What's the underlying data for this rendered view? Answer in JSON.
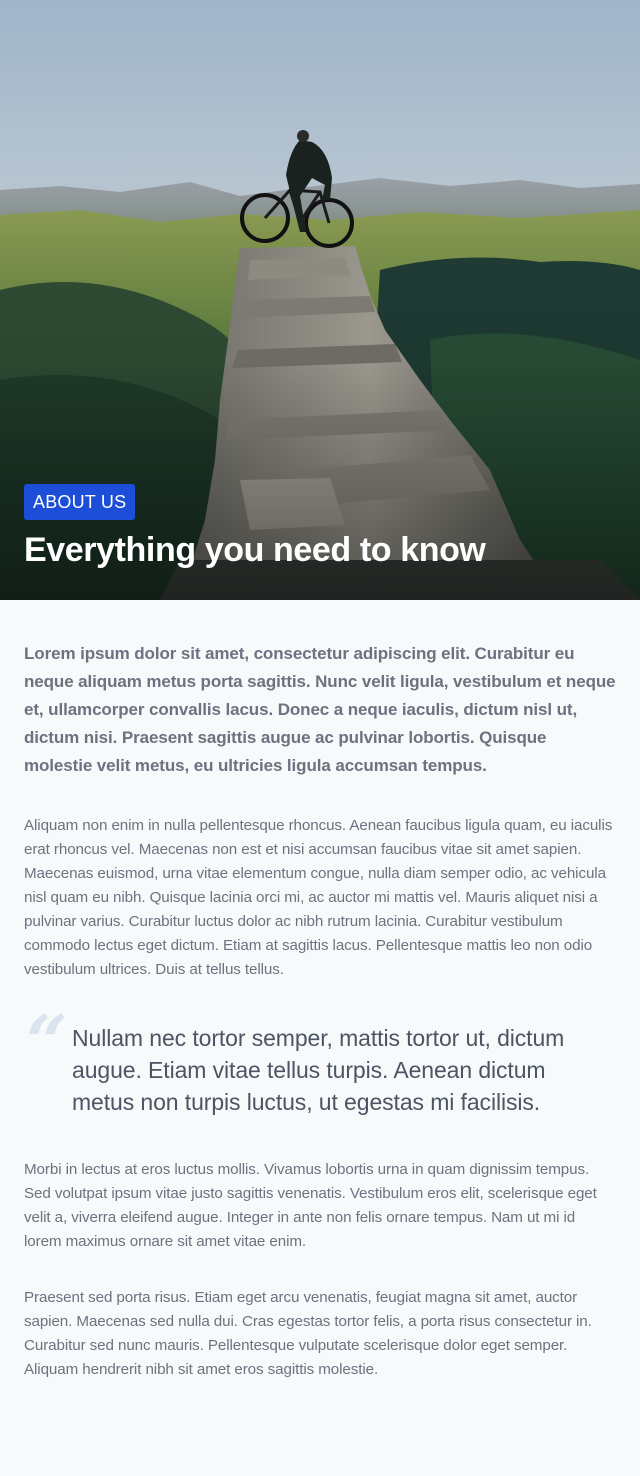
{
  "hero": {
    "image_alt": "Cyclist standing with a bicycle on top of a rock pillar above green mountains",
    "badge": "ABOUT US",
    "title": "Everything you need to know"
  },
  "lead": "Lorem ipsum dolor sit amet, consectetur adipiscing elit. Curabitur eu neque aliquam metus porta sagittis. Nunc velit ligula, vestibulum et neque et, ullamcorper convallis lacus. Donec a neque iaculis, dictum nisl ut, dictum nisi. Praesent sagittis augue ac pulvinar lobortis. Quisque molestie velit metus, eu ultricies ligula accumsan tempus.",
  "paragraphs": [
    "Aliquam non enim in nulla pellentesque rhoncus. Aenean faucibus ligula quam, eu iaculis erat rhoncus vel. Maecenas non est et nisi accumsan faucibus vitae sit amet sapien. Maecenas euismod, urna vitae elementum congue, nulla diam semper odio, ac vehicula nisl quam eu nibh. Quisque lacinia orci mi, ac auctor mi mattis vel. Mauris aliquet nisi a pulvinar varius. Curabitur luctus dolor ac nibh rutrum lacinia. Curabitur vestibulum commodo lectus eget dictum. Etiam at sagittis lacus. Pellentesque mattis leo non odio vestibulum ultrices. Duis at tellus tellus.",
    "Morbi in lectus at eros luctus mollis. Vivamus lobortis urna in quam dignissim tempus. Sed volutpat ipsum vitae justo sagittis venenatis. Vestibulum eros elit, scelerisque eget velit a, viverra eleifend augue. Integer in ante non felis ornare tempus. Nam ut mi id lorem maximus ornare sit amet vitae enim.",
    "Praesent sed porta risus. Etiam eget arcu venenatis, feugiat magna sit amet, auctor sapien. Maecenas sed nulla dui. Cras egestas tortor felis, a porta risus consectetur in. Curabitur sed nunc mauris. Pellentesque vulputate scelerisque dolor eget semper. Aliquam hendrerit nibh sit amet eros sagittis molestie."
  ],
  "quote": {
    "mark": "“",
    "text": "Nullam nec tortor semper, mattis tortor ut, dictum augue. Etiam vitae tellus turpis. Aenean dictum metus non turpis luctus, ut egestas mi facilisis."
  }
}
